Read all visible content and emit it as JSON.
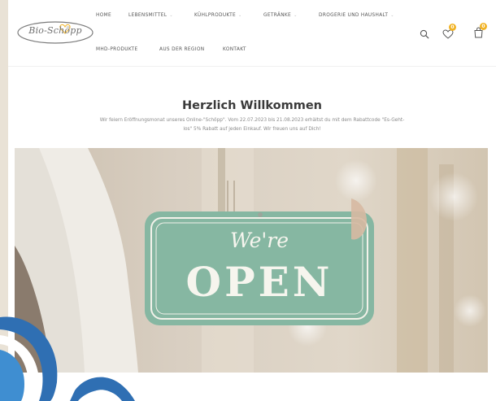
{
  "brand": {
    "logo_text": "Bio-Schöpp"
  },
  "nav": {
    "row1": [
      {
        "label": "HOME",
        "has_dropdown": false
      },
      {
        "label": "LEBENSMITTEL",
        "has_dropdown": true
      },
      {
        "label": "KÜHLPRODUKTE",
        "has_dropdown": true
      },
      {
        "label": "GETRÄNKE",
        "has_dropdown": true
      },
      {
        "label": "DROGERIE UND HAUSHALT",
        "has_dropdown": true
      }
    ],
    "row2": [
      {
        "label": "MHD-PRODUKTE"
      },
      {
        "label": "AUS DER REGION"
      },
      {
        "label": "KONTAKT"
      }
    ]
  },
  "header_icons": {
    "search": "search-icon",
    "wishlist": {
      "icon": "heart-icon",
      "count": "0"
    },
    "cart": {
      "icon": "shopping-bag-icon",
      "count": "0"
    }
  },
  "welcome": {
    "title": "Herzlich Willkommen",
    "text": "Wir feiern Eröffnungsmonat unseres Online-\"Schöpp\". Vom 22.07.2023 bis 21.08.2023 erhältst du mit dem Rabattcode \"Es-Geht-los\" 5% Rabatt auf jeden Einkauf. Wir freuen uns auf Dich!"
  },
  "hero": {
    "sign_script": "We're",
    "sign_word": "OPEN"
  },
  "colors": {
    "accent": "#f1b325",
    "sign_green": "#86b7a2",
    "decor_blue": "#2f6fb3",
    "left_strip": "#e9e2d6"
  }
}
